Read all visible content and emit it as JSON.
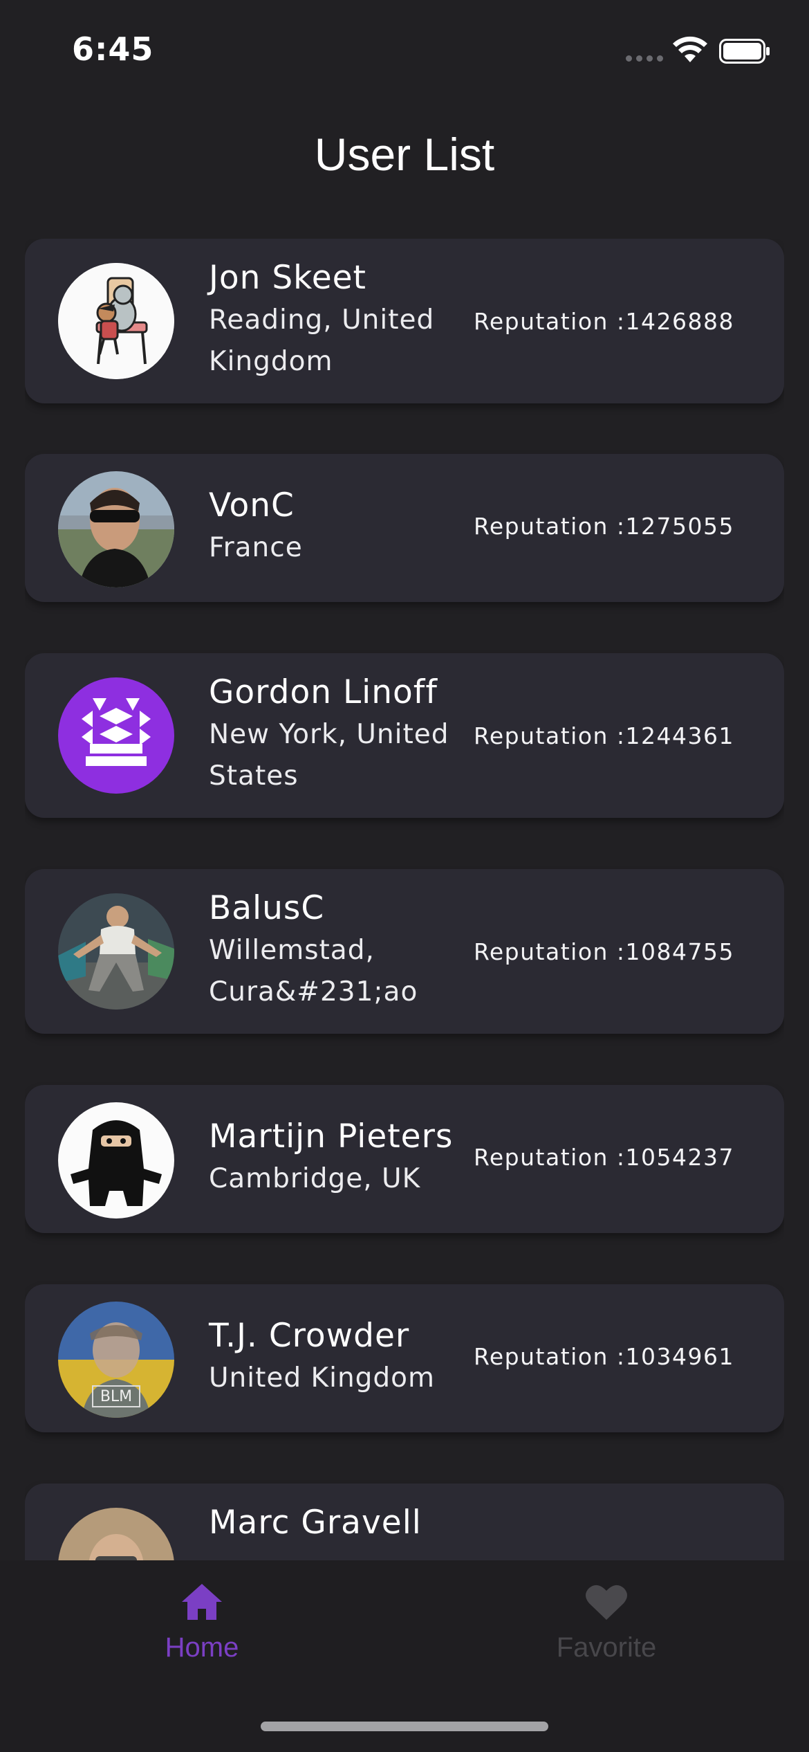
{
  "status_bar": {
    "time": "6:45"
  },
  "page": {
    "title": "User List"
  },
  "users": [
    {
      "name": "Jon Skeet",
      "location": "Reading, United Kingdom",
      "reputation": "Reputation :1426888",
      "avatar": "cartoon-avatar"
    },
    {
      "name": "VonC",
      "location": "France",
      "reputation": "Reputation :1275055",
      "avatar": "photo-avatar"
    },
    {
      "name": "Gordon Linoff",
      "location": "New York, United States",
      "reputation": "Reputation :1244361",
      "avatar": "identicon-avatar"
    },
    {
      "name": "BalusC",
      "location": "Willemstad, Cura&#231;ao",
      "reputation": "Reputation :1084755",
      "avatar": "photo-avatar"
    },
    {
      "name": "Martijn Pieters",
      "location": "Cambridge, UK",
      "reputation": "Reputation :1054237",
      "avatar": "ninja-avatar"
    },
    {
      "name": "T.J. Crowder",
      "location": "United Kingdom",
      "reputation": "Reputation :1034961",
      "avatar": "photo-avatar",
      "avatar_text": "BLM"
    },
    {
      "name": "Marc Gravell",
      "location": "",
      "reputation": "",
      "avatar": "photo-avatar"
    }
  ],
  "bottom_nav": {
    "items": [
      {
        "label": "Home",
        "icon": "home-icon",
        "active": true
      },
      {
        "label": "Favorite",
        "icon": "heart-icon",
        "active": false
      }
    ]
  },
  "colors": {
    "background": "#212023",
    "card": "#2b2a33",
    "accent": "#7b3fc4",
    "inactive": "#4a494d"
  }
}
